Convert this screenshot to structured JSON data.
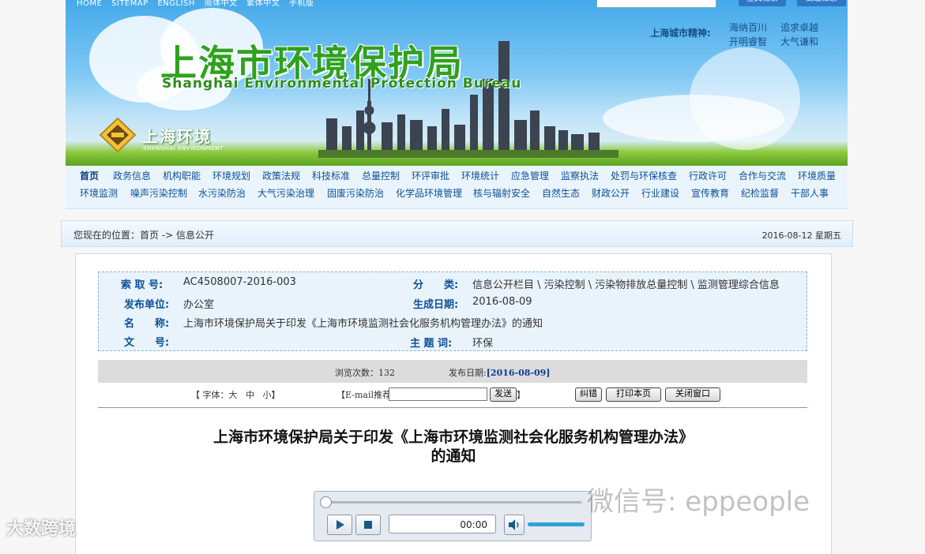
{
  "header": {
    "top_links": [
      "HOME",
      "SITEMAP",
      "ENGLISH",
      "简体中文",
      "繁体中文",
      "手机版"
    ],
    "search_buttons": [
      "全文检索",
      "高级检索"
    ],
    "title_cn": "上海市环境保护局",
    "title_en": "Shanghai Environmental Protection Bureau",
    "spirit_label": "上海城市精神:",
    "spirit_phrases": [
      "海纳百川",
      "追求卓越",
      "开明睿智",
      "大气谦和"
    ],
    "logo_cn": "上海环境",
    "logo_en": "SHANGHAI ENVIRONMENT"
  },
  "nav": {
    "row1": [
      "首页",
      "政务信息",
      "机构职能",
      "环境规划",
      "政策法规",
      "科技标准",
      "总量控制",
      "环评审批",
      "环境统计",
      "应急管理",
      "监察执法",
      "处罚与环保核查",
      "行政许可",
      "合作与交流",
      "环境质量"
    ],
    "row2": [
      "环境监测",
      "噪声污染控制",
      "水污染防治",
      "大气污染治理",
      "固废污染防治",
      "化学品环境管理",
      "核与辐射安全",
      "自然生态",
      "财政公开",
      "行业建设",
      "宣传教育",
      "纪检监督",
      "干部人事"
    ]
  },
  "breadcrumb": {
    "prefix": "您现在的位置：",
    "home": "首页",
    "sep": " -> ",
    "current": "信息公开",
    "date": "2016-08-12  星期五"
  },
  "meta": {
    "index_label": "索 取 号:",
    "index_value": "AC4508007-2016-003",
    "category_label": "分　　类:",
    "category_value": "信息公开栏目 \\ 污染控制 \\ 污染物排放总量控制 \\ 监测管理综合信息",
    "publisher_label": "发布单位:",
    "publisher_value": "办公室",
    "gen_date_label": "生成日期:",
    "gen_date_value": "2016-08-09",
    "name_label": "名　　称:",
    "name_value": "上海市环境保护局关于印发《上海市环境监测社会化服务机构管理办法》的通知",
    "docno_label": "文　　号:",
    "docno_value": "",
    "keyword_label": "主 题 词:",
    "keyword_value": "环保"
  },
  "stats": {
    "views_label": "浏览次数：",
    "views_value": "132",
    "pub_label": "发布日期:",
    "pub_value": "[2016-08-09]"
  },
  "tools": {
    "font_open": "【 字体：",
    "font_large": "大",
    "font_medium": "中",
    "font_small": "小",
    "font_close": "】",
    "email_label": "【E-mail推荐",
    "email_close": "】",
    "send": "发送",
    "correct": "纠错",
    "print": "打印本页",
    "close": "关闭窗口"
  },
  "article": {
    "title_line1": "上海市环境保护局关于印发《上海市环境监测社会化服务机构管理办法》",
    "title_line2": "的通知"
  },
  "player": {
    "time": "00:00",
    "progress": 0,
    "volume": 1.0
  },
  "watermarks": {
    "wechat": "微信号: eppeople",
    "brand": "大数跨境"
  }
}
